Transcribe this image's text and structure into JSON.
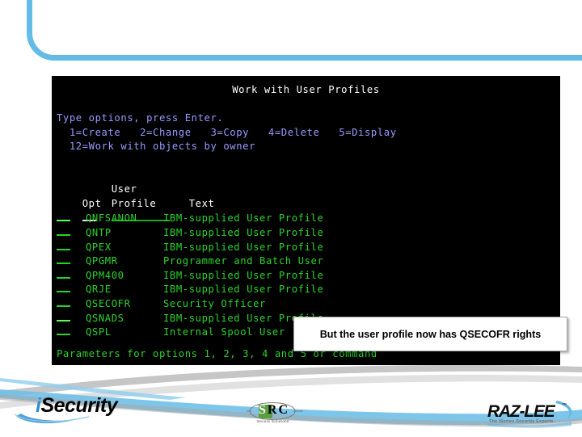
{
  "slide": {
    "frame_color": "#63bbe6",
    "background": "#ffffff"
  },
  "terminal": {
    "background": "#000000",
    "title": "Work with User Profiles",
    "instruction": "Type options, press Enter.",
    "options_line_1": "  1=Create   2=Change   3=Copy   4=Delete   5=Display",
    "options_line_2": "  12=Work with objects by owner",
    "header_user": "       User",
    "header_row": "Opt    Profile      Text",
    "header_opt": "Opt",
    "header_profile": "Profile",
    "header_user_word": "User",
    "header_text": "Text",
    "bottom_line": "Parameters for options 1, 2, 3, 4 and 5 or command",
    "colors": {
      "title": "#ffffff",
      "instruction": "#9a9aff",
      "options": "#9a9aff",
      "headers": "#ffffff",
      "rows": "#2ad32a"
    },
    "rows": [
      {
        "opt": "",
        "profile": "QNFSANON",
        "text": "IBM-supplied User Profile"
      },
      {
        "opt": "",
        "profile": "QNTP",
        "text": "IBM-supplied User Profile"
      },
      {
        "opt": "",
        "profile": "QPEX",
        "text": "IBM-supplied User Profile"
      },
      {
        "opt": "",
        "profile": "QPGMR",
        "text": "Programmer and Batch User"
      },
      {
        "opt": "",
        "profile": "QPM400",
        "text": "IBM-supplied User Profile"
      },
      {
        "opt": "",
        "profile": "QRJE",
        "text": "IBM-supplied User Profile"
      },
      {
        "opt": "",
        "profile": "QSECOFR",
        "text": "Security Officer"
      },
      {
        "opt": "",
        "profile": "QSNADS",
        "text": "IBM-supplied User Profile"
      },
      {
        "opt": "",
        "profile": "QSPL",
        "text": "Internal Spool User"
      }
    ]
  },
  "callout": {
    "text": "But the user profile now has QSECOFR rights",
    "background": "#ffffff",
    "border": "#a6a6a6"
  },
  "logos": {
    "isecurity": {
      "prefix": "i",
      "name": "Security",
      "accent": "#2f8fd0"
    },
    "src": {
      "letters": "SRC",
      "letter_s": "S",
      "letter_r": "R",
      "letter_c": "C",
      "tagline": "Secure Solutions",
      "accent": "#5a9e42"
    },
    "razlee": {
      "name": "RAZ-LEE",
      "trademark": "™",
      "tagline": "The iSeries Security Experts",
      "accent": "#62b5e0"
    }
  }
}
